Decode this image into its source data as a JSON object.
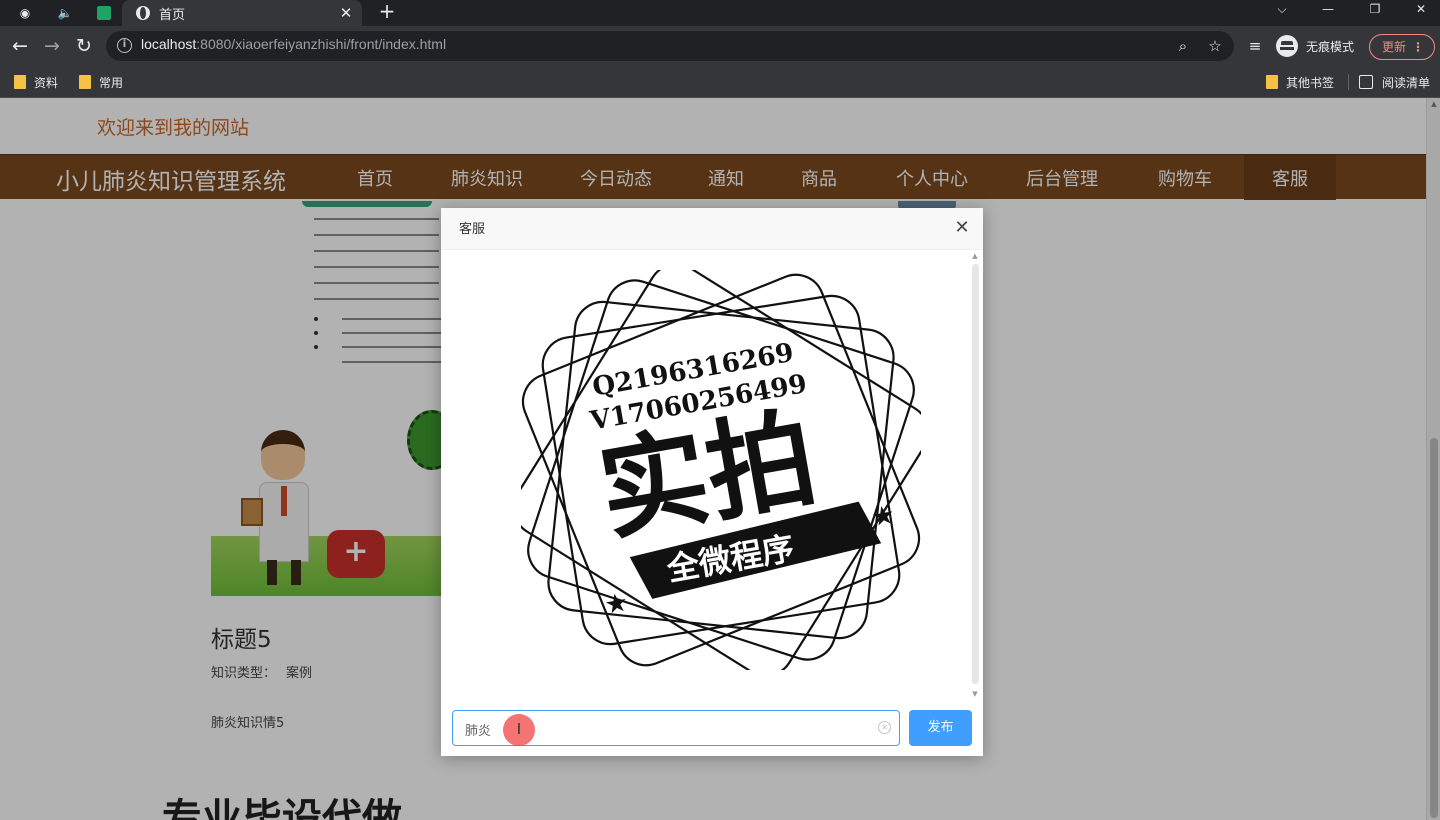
{
  "browser": {
    "tab_title": "首页",
    "url_host": "localhost",
    "url_rest": ":8080/xiaoerfeiyanzhishi/front/index.html",
    "incognito_label": "无痕模式",
    "update_label": "更新",
    "bookmarks": [
      "资料",
      "常用"
    ],
    "other_bookmarks": "其他书签",
    "reading_list": "阅读清单"
  },
  "site": {
    "welcome": "欢迎来到我的网站",
    "brand": "小儿肺炎知识管理系统",
    "nav": [
      "首页",
      "肺炎知识",
      "今日动态",
      "通知",
      "商品",
      "个人中心",
      "后台管理",
      "购物车",
      "客服"
    ],
    "active_nav": "客服"
  },
  "card": {
    "title": "标题5",
    "type_label": "知识类型：",
    "type_value": "案例",
    "description": "肺炎知识情5"
  },
  "section_heading": "专业毕设代做",
  "modal": {
    "title": "客服",
    "input_value": "肺炎",
    "send_label": "发布",
    "stamp": {
      "line1": "Q2196316269",
      "line2": "V17060256499",
      "main": "实拍",
      "ribbon": "全微程序"
    }
  },
  "colors": {
    "nav_bg": "#7a4a1e",
    "welcome": "#c7692b",
    "primary": "#409eff"
  }
}
